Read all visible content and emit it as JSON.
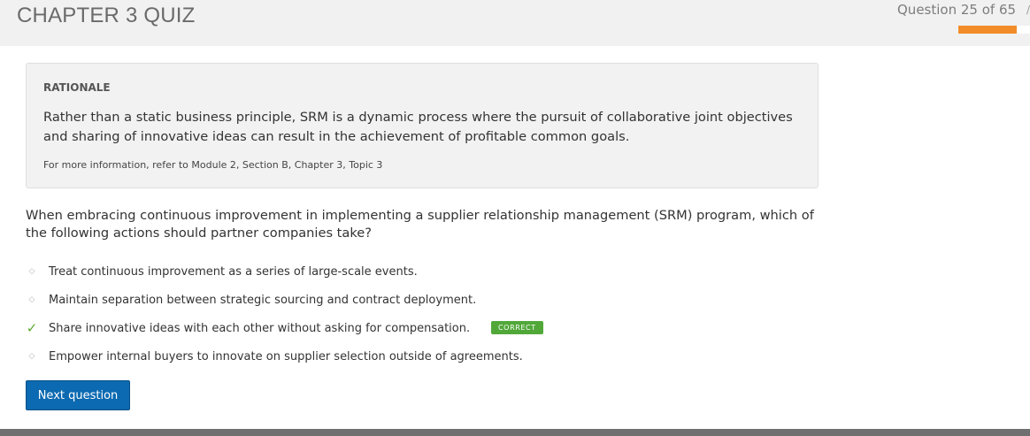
{
  "header": {
    "title": "CHAPTER 3 QUIZ",
    "progress_text": "Question 25 of 65",
    "progress": {
      "current": 25,
      "total": 65,
      "fraction": 0.81
    },
    "accent_color": "#f28c28"
  },
  "rationale": {
    "label": "RATIONALE",
    "body": "Rather than a static business principle, SRM is a dynamic process where the pursuit of collaborative joint objectives and sharing of innovative ideas can result in the achievement of profitable common goals.",
    "reference": "For more information, refer to Module 2, Section B, Chapter 3, Topic 3"
  },
  "question": {
    "text": "When embracing continuous improvement in implementing a supplier relationship management (SRM) program, which of the following actions should partner companies take?",
    "options": [
      {
        "text": "Treat continuous improvement as a series of large-scale events.",
        "icon": "diamond-bullet-icon"
      },
      {
        "text": "Maintain separation between strategic sourcing and contract deployment.",
        "icon": "diamond-bullet-icon"
      },
      {
        "text": "Share innovative ideas with each other without asking for compensation.",
        "icon": "check-icon",
        "badge": "CORRECT"
      },
      {
        "text": "Empower internal buyers to innovate on supplier selection outside of agreements.",
        "icon": "diamond-bullet-icon"
      }
    ]
  },
  "actions": {
    "next_label": "Next question"
  },
  "colors": {
    "correct": "#51a839",
    "button": "#0b6ab1"
  }
}
